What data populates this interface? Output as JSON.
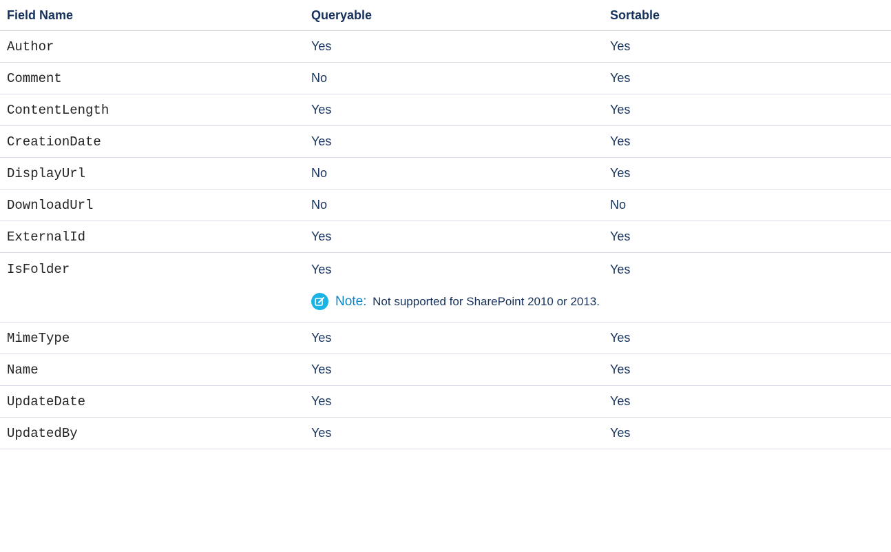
{
  "table": {
    "headers": [
      "Field Name",
      "Queryable",
      "Sortable"
    ],
    "rows": [
      {
        "name": "Author",
        "queryable": "Yes",
        "sortable": "Yes"
      },
      {
        "name": "Comment",
        "queryable": "No",
        "sortable": "Yes"
      },
      {
        "name": "ContentLength",
        "queryable": "Yes",
        "sortable": "Yes"
      },
      {
        "name": "CreationDate",
        "queryable": "Yes",
        "sortable": "Yes"
      },
      {
        "name": "DisplayUrl",
        "queryable": "No",
        "sortable": "Yes"
      },
      {
        "name": "DownloadUrl",
        "queryable": "No",
        "sortable": "No"
      },
      {
        "name": "ExternalId",
        "queryable": "Yes",
        "sortable": "Yes"
      },
      {
        "name": "IsFolder",
        "queryable": "Yes",
        "sortable": "Yes",
        "note_label": "Note:",
        "note_text": "Not supported for SharePoint 2010 or 2013."
      },
      {
        "name": "MimeType",
        "queryable": "Yes",
        "sortable": "Yes"
      },
      {
        "name": "Name",
        "queryable": "Yes",
        "sortable": "Yes"
      },
      {
        "name": "UpdateDate",
        "queryable": "Yes",
        "sortable": "Yes"
      },
      {
        "name": "UpdatedBy",
        "queryable": "Yes",
        "sortable": "Yes"
      }
    ]
  },
  "icons": {
    "note_icon": "edit-note-icon"
  },
  "colors": {
    "text": "#16325c",
    "note_accent": "#0a84c5",
    "note_icon_bg": "#1ab3e5",
    "divider": "#d8dde6"
  }
}
